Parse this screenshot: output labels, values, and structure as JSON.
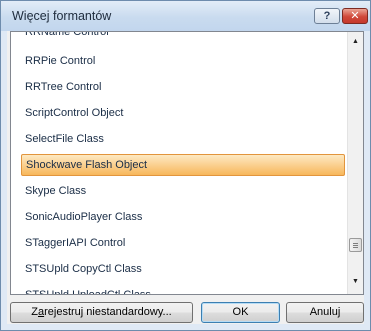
{
  "dialog": {
    "title": "Więcej formantów",
    "help_glyph": "?",
    "close_glyph": "✕"
  },
  "controls_list": {
    "items": [
      "RRName Control",
      "RRPie Control",
      "RRTree Control",
      "ScriptControl Object",
      "SelectFile Class",
      "Shockwave Flash Object",
      "Skype Class",
      "SonicAudioPlayer Class",
      "STaggerIAPI Control",
      "STSUpld CopyCtl Class",
      "STSUpld UploadCtl Class"
    ],
    "selected_item": "Shockwave Flash Object"
  },
  "scrollbar": {
    "up_glyph": "▲",
    "down_glyph": "▼"
  },
  "buttons": {
    "register_mnemonic": "a",
    "register_pre": "Z",
    "register_rest": "rejestruj niestandardowy...",
    "ok": "OK",
    "cancel": "Anuluj"
  },
  "colors": {
    "selection_fill": "#fbd090",
    "selection_border": "#e2953d",
    "item_text": "#1a2d46"
  }
}
